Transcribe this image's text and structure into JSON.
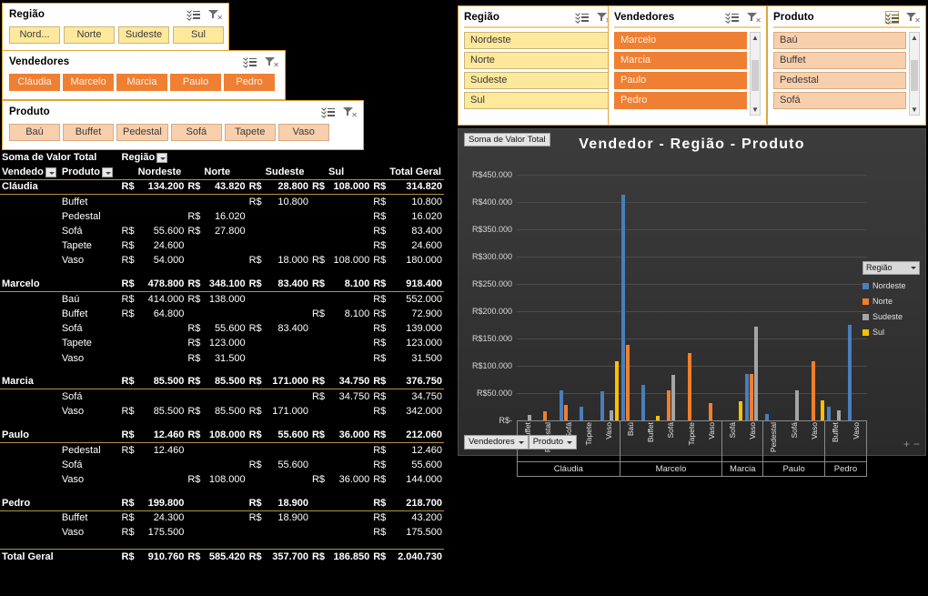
{
  "left_slicers": {
    "regiao": {
      "title": "Região",
      "icons": [
        "multi-select-icon",
        "clear-filter-icon"
      ],
      "buttons": [
        "Nord...",
        "Norte",
        "Sudeste",
        "Sul"
      ]
    },
    "vendedores": {
      "title": "Vendedores",
      "icons": [
        "multi-select-icon",
        "clear-filter-icon"
      ],
      "buttons": [
        "Cláudia",
        "Marcelo",
        "Marcia",
        "Paulo",
        "Pedro"
      ]
    },
    "produto": {
      "title": "Produto",
      "icons": [
        "multi-select-icon",
        "clear-filter-icon"
      ],
      "buttons": [
        "Baú",
        "Buffet",
        "Pedestal",
        "Sofá",
        "Tapete",
        "Vaso"
      ]
    }
  },
  "right_slicers": {
    "regiao": {
      "title": "Região",
      "items": [
        "Nordeste",
        "Norte",
        "Sudeste",
        "Sul"
      ],
      "scroll": false
    },
    "vendedores": {
      "title": "Vendedores",
      "items": [
        "Marcelo",
        "Marcia",
        "Paulo",
        "Pedro"
      ],
      "scroll": true
    },
    "produto": {
      "title": "Produto",
      "items": [
        "Baú",
        "Buffet",
        "Pedestal",
        "Sofá"
      ],
      "scroll": true
    }
  },
  "pivot": {
    "value_caption": "Soma de Valor Total",
    "column_field": "Região",
    "row_field_1": "Vendedo",
    "row_field_2": "Produto",
    "columns": [
      "Nordeste",
      "Norte",
      "Sudeste",
      "Sul"
    ],
    "total_label": "Total Geral",
    "currency": "R$",
    "groups": [
      {
        "name": "Cláudia",
        "totals": [
          "134.200",
          "43.820",
          "28.800",
          "108.000"
        ],
        "grand": "314.820",
        "rows": [
          {
            "produto": "Buffet",
            "values": [
              "",
              "",
              "10.800",
              ""
            ],
            "total": "10.800"
          },
          {
            "produto": "Pedestal",
            "values": [
              "",
              "16.020",
              "",
              ""
            ],
            "total": "16.020"
          },
          {
            "produto": "Sofá",
            "values": [
              "55.600",
              "27.800",
              "",
              ""
            ],
            "total": "83.400"
          },
          {
            "produto": "Tapete",
            "values": [
              "24.600",
              "",
              "",
              ""
            ],
            "total": "24.600"
          },
          {
            "produto": "Vaso",
            "values": [
              "54.000",
              "",
              "18.000",
              "108.000"
            ],
            "total": "180.000"
          }
        ]
      },
      {
        "name": "Marcelo",
        "totals": [
          "478.800",
          "348.100",
          "83.400",
          "8.100"
        ],
        "grand": "918.400",
        "rows": [
          {
            "produto": "Baú",
            "values": [
              "414.000",
              "138.000",
              "",
              ""
            ],
            "total": "552.000"
          },
          {
            "produto": "Buffet",
            "values": [
              "64.800",
              "",
              "",
              "8.100"
            ],
            "total": "72.900"
          },
          {
            "produto": "Sofá",
            "values": [
              "",
              "55.600",
              "83.400",
              ""
            ],
            "total": "139.000"
          },
          {
            "produto": "Tapete",
            "values": [
              "",
              "123.000",
              "",
              ""
            ],
            "total": "123.000"
          },
          {
            "produto": "Vaso",
            "values": [
              "",
              "31.500",
              "",
              ""
            ],
            "total": "31.500"
          }
        ]
      },
      {
        "name": "Marcia",
        "totals": [
          "85.500",
          "85.500",
          "171.000",
          "34.750"
        ],
        "grand": "376.750",
        "rows": [
          {
            "produto": "Sofá",
            "values": [
              "",
              "",
              "",
              "34.750"
            ],
            "total": "34.750"
          },
          {
            "produto": "Vaso",
            "values": [
              "85.500",
              "85.500",
              "171.000",
              ""
            ],
            "total": "342.000"
          }
        ]
      },
      {
        "name": "Paulo",
        "totals": [
          "12.460",
          "108.000",
          "55.600",
          "36.000"
        ],
        "grand": "212.060",
        "rows": [
          {
            "produto": "Pedestal",
            "values": [
              "12.460",
              "",
              "",
              ""
            ],
            "total": "12.460"
          },
          {
            "produto": "Sofá",
            "values": [
              "",
              "",
              "55.600",
              ""
            ],
            "total": "55.600"
          },
          {
            "produto": "Vaso",
            "values": [
              "",
              "108.000",
              "",
              "36.000"
            ],
            "total": "144.000"
          }
        ]
      },
      {
        "name": "Pedro",
        "totals": [
          "199.800",
          "",
          "18.900",
          ""
        ],
        "grand": "218.700",
        "rows": [
          {
            "produto": "Buffet",
            "values": [
              "24.300",
              "",
              "18.900",
              ""
            ],
            "total": "43.200"
          },
          {
            "produto": "Vaso",
            "values": [
              "175.500",
              "",
              "",
              ""
            ],
            "total": "175.500"
          }
        ]
      }
    ],
    "grand_total": {
      "label": "Total Geral",
      "values": [
        "910.760",
        "585.420",
        "357.700",
        "186.850"
      ],
      "total": "2.040.730"
    }
  },
  "chart": {
    "field_button": "Soma de Valor Total",
    "title": "Vendedor - Região - Produto",
    "legend_button": "Região",
    "bottom_buttons": [
      "Vendedores",
      "Produto"
    ],
    "zoom_in": "+",
    "zoom_out": "−"
  },
  "chart_data": {
    "type": "bar",
    "title": "Vendedor - Região - Produto",
    "xlabel": "",
    "ylabel": "",
    "ylim": [
      0,
      450000
    ],
    "ytick_labels": [
      "R$-",
      "R$50.000",
      "R$100.000",
      "R$150.000",
      "R$200.000",
      "R$250.000",
      "R$300.000",
      "R$350.000",
      "R$400.000",
      "R$450.000"
    ],
    "ytick_values": [
      0,
      50000,
      100000,
      150000,
      200000,
      250000,
      300000,
      350000,
      400000,
      450000
    ],
    "grid": true,
    "legend_position": "right",
    "legend_title": "Região",
    "series": [
      {
        "name": "Nordeste",
        "color": "#4a7ebb"
      },
      {
        "name": "Norte",
        "color": "#f07f2c"
      },
      {
        "name": "Sudeste",
        "color": "#a5a5a5"
      },
      {
        "name": "Sul",
        "color": "#ffc000"
      }
    ],
    "groups": [
      {
        "name": "Cláudia",
        "categories": [
          {
            "label": "Buffet",
            "values": [
              0,
              0,
              10800,
              0
            ]
          },
          {
            "label": "Pedestal",
            "values": [
              0,
              16020,
              0,
              0
            ]
          },
          {
            "label": "Sofá",
            "values": [
              55600,
              27800,
              0,
              0
            ]
          },
          {
            "label": "Tapete",
            "values": [
              24600,
              0,
              0,
              0
            ]
          },
          {
            "label": "Vaso",
            "values": [
              54000,
              0,
              18000,
              108000
            ]
          }
        ]
      },
      {
        "name": "Marcelo",
        "categories": [
          {
            "label": "Baú",
            "values": [
              414000,
              138000,
              0,
              0
            ]
          },
          {
            "label": "Buffet",
            "values": [
              64800,
              0,
              0,
              8100
            ]
          },
          {
            "label": "Sofá",
            "values": [
              0,
              55600,
              83400,
              0
            ]
          },
          {
            "label": "Tapete",
            "values": [
              0,
              123000,
              0,
              0
            ]
          },
          {
            "label": "Vaso",
            "values": [
              0,
              31500,
              0,
              0
            ]
          }
        ]
      },
      {
        "name": "Marcia",
        "categories": [
          {
            "label": "Sofá",
            "values": [
              0,
              0,
              0,
              34750
            ]
          },
          {
            "label": "Vaso",
            "values": [
              85500,
              85500,
              171000,
              0
            ]
          }
        ]
      },
      {
        "name": "Paulo",
        "categories": [
          {
            "label": "Pedestal",
            "values": [
              12460,
              0,
              0,
              0
            ]
          },
          {
            "label": "Sofá",
            "values": [
              0,
              0,
              55600,
              0
            ]
          },
          {
            "label": "Vaso",
            "values": [
              0,
              108000,
              0,
              36000
            ]
          }
        ]
      },
      {
        "name": "Pedro",
        "categories": [
          {
            "label": "Buffet",
            "values": [
              24300,
              0,
              18900,
              0
            ]
          },
          {
            "label": "Vaso",
            "values": [
              175500,
              0,
              0,
              0
            ]
          }
        ]
      }
    ]
  }
}
